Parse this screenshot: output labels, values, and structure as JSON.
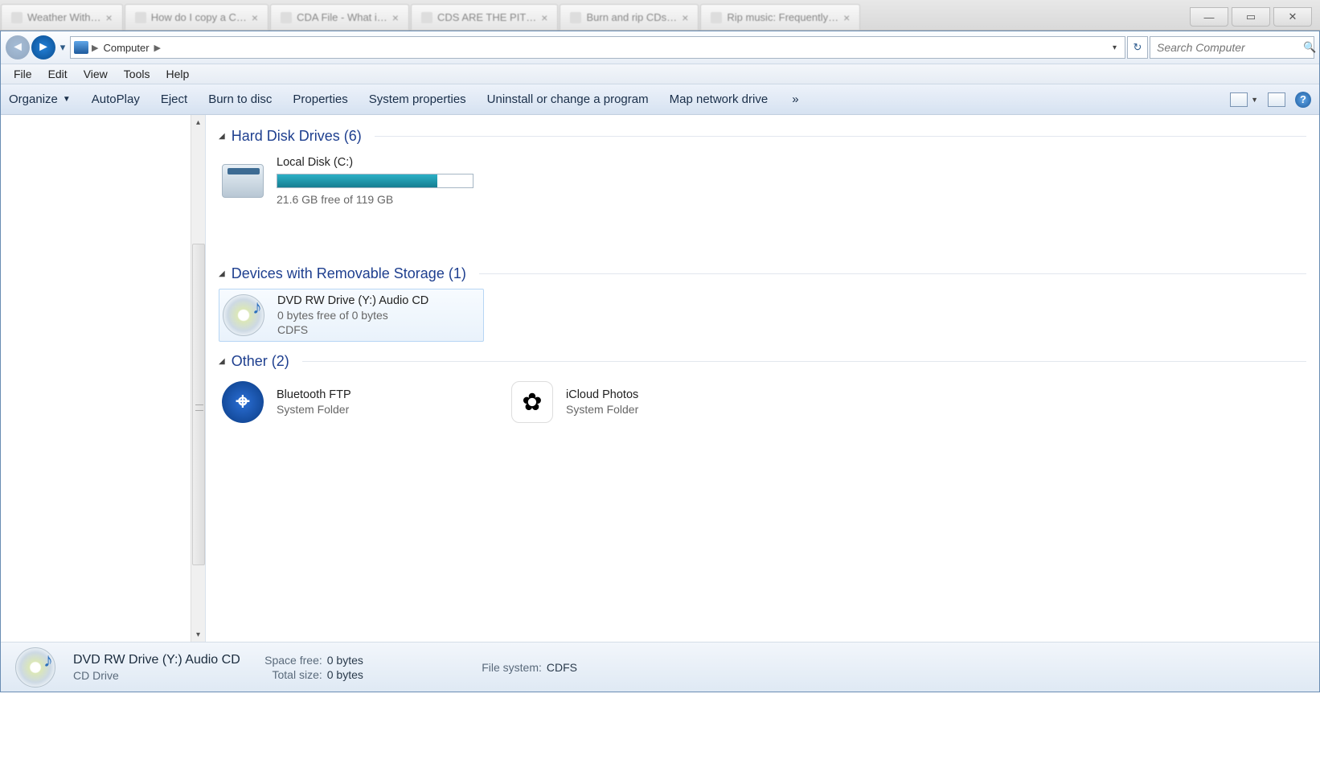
{
  "tabs": [
    {
      "title": "Weather With…",
      "fav": "#e44"
    },
    {
      "title": "How do I copy a C…",
      "fav": "#4a4"
    },
    {
      "title": "CDA File - What i…",
      "fav": "#48c"
    },
    {
      "title": "CDS ARE THE PIT…",
      "fav": "#333"
    },
    {
      "title": "Burn and rip CDs…",
      "fav": "#4a4"
    },
    {
      "title": "Rip music: Frequently…",
      "fav": "#888"
    }
  ],
  "breadcrumb": {
    "root": "Computer"
  },
  "search": {
    "placeholder": "Search Computer"
  },
  "menu": {
    "file": "File",
    "edit": "Edit",
    "view": "View",
    "tools": "Tools",
    "help": "Help"
  },
  "toolbar": {
    "organize": "Organize",
    "autoplay": "AutoPlay",
    "eject": "Eject",
    "burn": "Burn to disc",
    "props": "Properties",
    "sysprops": "System properties",
    "uninstall": "Uninstall or change a program",
    "mapdrive": "Map network drive",
    "more": "»"
  },
  "groups": {
    "hdd": {
      "title": "Hard Disk Drives (6)"
    },
    "removable": {
      "title": "Devices with Removable Storage (1)"
    },
    "other": {
      "title": "Other (2)"
    }
  },
  "drives": {
    "local": {
      "name": "Local Disk (C:)",
      "free": "21.6 GB free of 119 GB",
      "pct": 82
    },
    "dvd": {
      "name": "DVD RW Drive (Y:) Audio CD",
      "free": "0 bytes free of 0 bytes",
      "fs": "CDFS"
    }
  },
  "other_items": {
    "bt": {
      "name": "Bluetooth FTP",
      "sub": "System Folder"
    },
    "icloud": {
      "name": "iCloud Photos",
      "sub": "System Folder"
    }
  },
  "status": {
    "title": "DVD RW Drive (Y:) Audio CD",
    "type": "CD Drive",
    "space_free_label": "Space free:",
    "space_free": "0 bytes",
    "total_size_label": "Total size:",
    "total_size": "0 bytes",
    "fs_label": "File system:",
    "fs": "CDFS"
  }
}
